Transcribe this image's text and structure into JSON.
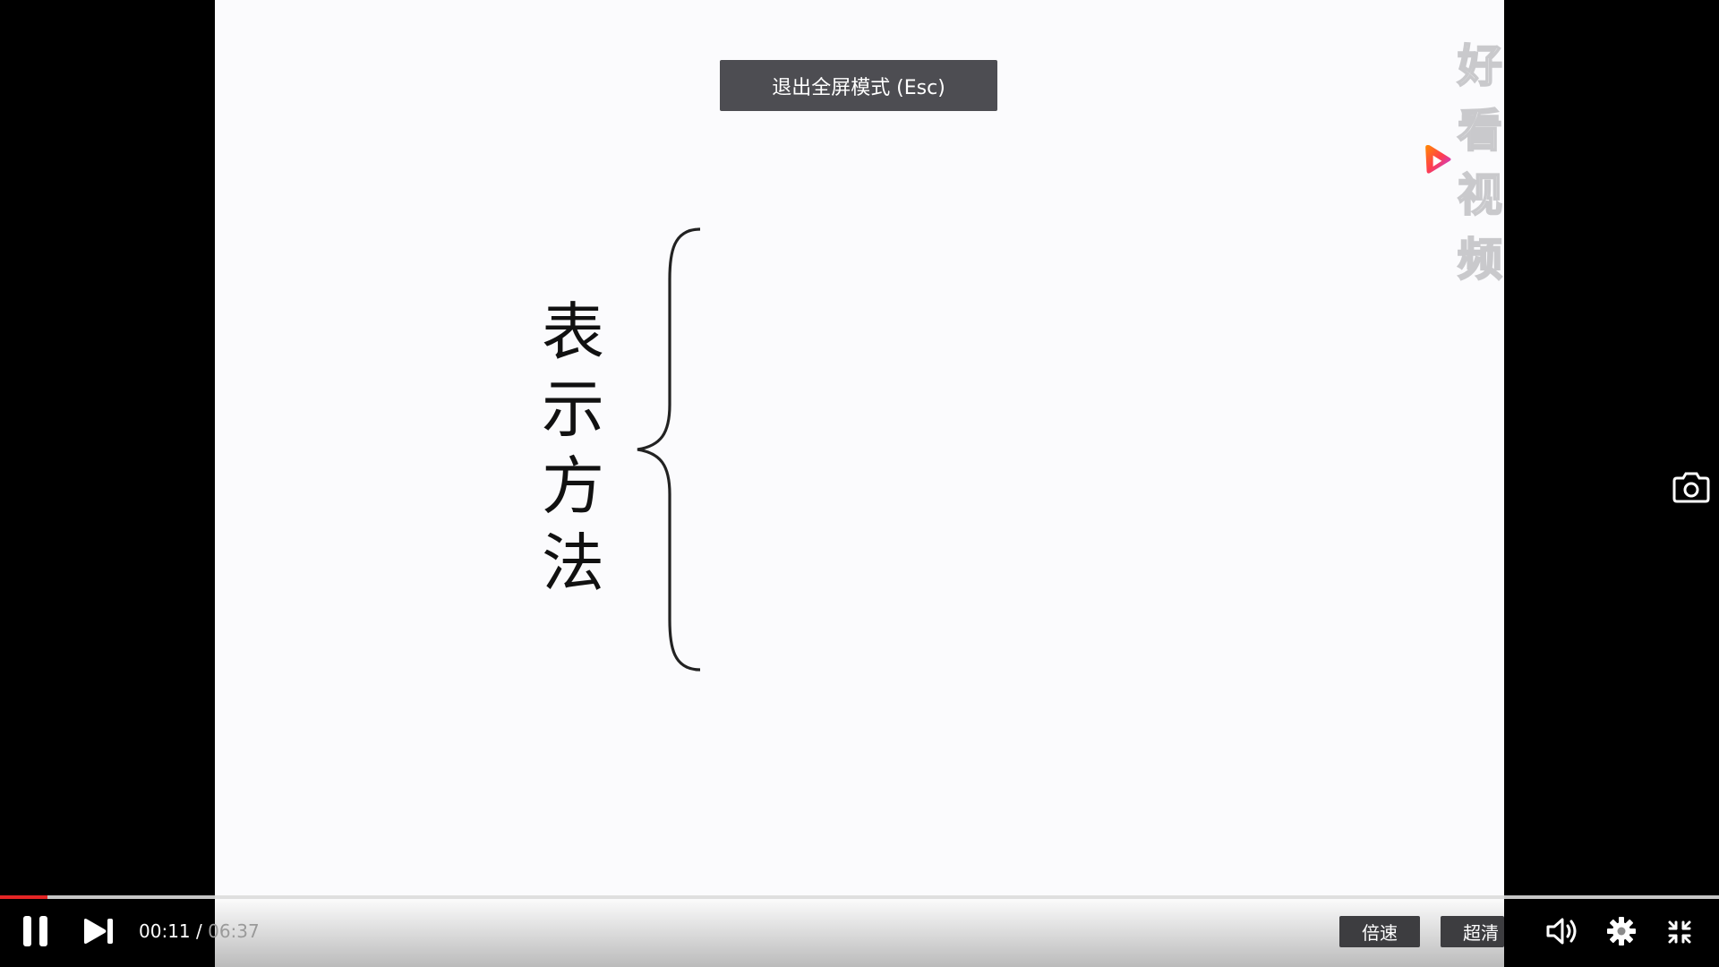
{
  "video": {
    "slide_title_chars": [
      "表",
      "示",
      "方",
      "法"
    ]
  },
  "logo": {
    "text": "好看视频",
    "mark_colors": [
      "#ff4a3d",
      "#ff8a00",
      "#b43cff"
    ]
  },
  "overlay": {
    "exit_fullscreen": "退出全屏模式 (Esc)"
  },
  "controls": {
    "current_time": "00:11",
    "separator": " / ",
    "total_time": "06:37",
    "progress_fraction": 0.0277,
    "speed_label": "倍速",
    "quality_label": "超清",
    "icons": {
      "pause": "pause-icon",
      "next": "next-icon",
      "volume": "volume-icon",
      "settings": "gear-icon",
      "exit_fullscreen": "exit-fullscreen-icon",
      "screenshot": "camera-icon"
    },
    "accent_color": "#e52525"
  }
}
